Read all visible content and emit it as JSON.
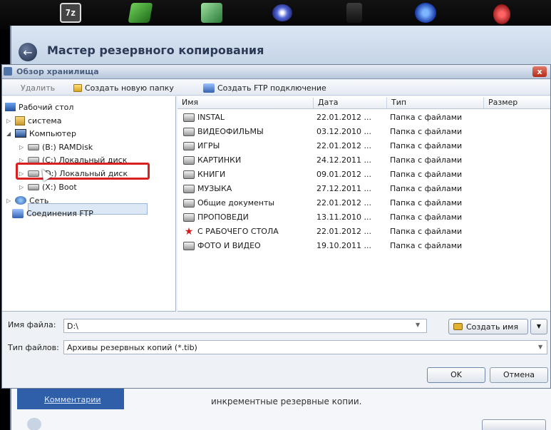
{
  "taskbar": {
    "seven_zip_label": "7z"
  },
  "wizard": {
    "title": "Мастер резервного копирования",
    "comments_label": "Комментарии",
    "note_text": "инкрементные резервные копии."
  },
  "dialog": {
    "title": "Обзор хранилища",
    "close_label": "x"
  },
  "toolbar": {
    "delete_label": "Удалить",
    "new_folder_label": "Создать новую папку",
    "ftp_label": "Создать FTP подключение"
  },
  "tree": {
    "items": [
      {
        "label": "Рабочий стол",
        "icon": "desktop-icon"
      },
      {
        "label": "система",
        "icon": "folder-icon"
      },
      {
        "label": "Компьютер",
        "icon": "computer-icon"
      },
      {
        "label": "(B:) RAMDisk",
        "icon": "drive-icon"
      },
      {
        "label": "(C:) Локальный диск",
        "icon": "drive-icon"
      },
      {
        "label": "(D:) Локальный диск",
        "icon": "drive-icon",
        "selected": true
      },
      {
        "label": "(X:) Boot",
        "icon": "drive-icon"
      },
      {
        "label": "Сеть",
        "icon": "network-icon"
      },
      {
        "label": "Соединения FTP",
        "icon": "ftp-icon"
      }
    ]
  },
  "filelist": {
    "columns": [
      "Имя",
      "Дата",
      "Тип",
      "Размер"
    ],
    "rows": [
      {
        "name": "INSTAL",
        "date": "22.01.2012 ...",
        "type": "Папка с файлами"
      },
      {
        "name": "ВИДЕОФИЛЬМЫ",
        "date": "03.12.2010 ...",
        "type": "Папка с файлами"
      },
      {
        "name": "ИГРЫ",
        "date": "22.01.2012 ...",
        "type": "Папка с файлами"
      },
      {
        "name": "КАРТИНКИ",
        "date": "24.12.2011 ...",
        "type": "Папка с файлами"
      },
      {
        "name": "КНИГИ",
        "date": "09.01.2012 ...",
        "type": "Папка с файлами"
      },
      {
        "name": "МУЗЫКА",
        "date": "27.12.2011 ...",
        "type": "Папка с файлами"
      },
      {
        "name": "Общие документы",
        "date": "22.01.2012 ...",
        "type": "Папка с файлами"
      },
      {
        "name": "ПРОПОВЕДИ",
        "date": "13.11.2010 ...",
        "type": "Папка с файлами"
      },
      {
        "name": "С РАБОЧЕГО СТОЛА",
        "date": "22.01.2012 ...",
        "type": "Папка с файлами"
      },
      {
        "name": "ФОТО И ВИДЕО",
        "date": "19.10.2011 ...",
        "type": "Папка с файлами"
      }
    ]
  },
  "fields": {
    "filename_label": "Имя файла:",
    "filename_value": "D:\\",
    "create_name_label": "Создать имя",
    "filetype_label": "Тип файлов:",
    "filetype_value": "Архивы резервных копий (*.tib)",
    "ok_label": "OK",
    "cancel_label": "Отмена"
  },
  "colors": {
    "selection_outline": "#d82020",
    "wizard_accent": "#2f5fa8"
  }
}
